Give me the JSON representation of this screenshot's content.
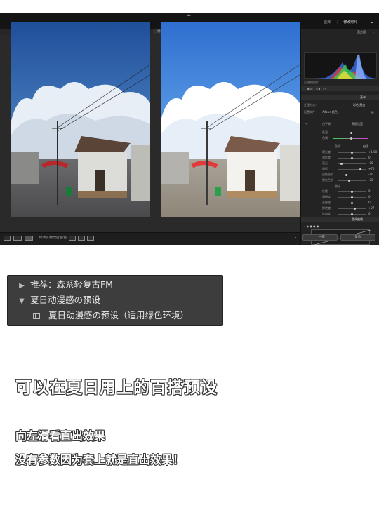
{
  "app": {
    "modules": [
      "图库",
      "修改照片"
    ],
    "active_module": "修改照片",
    "cloud_icon": "cloud-icon"
  },
  "view": {
    "before_label": "修改前",
    "after_label": "修改后",
    "toolbar_text": "修改前/修改后左/右"
  },
  "panel": {
    "histogram_label": "直方图",
    "basic_label": "基本",
    "profile_label": "配置文件",
    "profile_value": "Adobe 颜色",
    "wb_label": "白平衡",
    "wb_value": "原照设置",
    "tone_label": "色调",
    "auto_label": "自动",
    "presence_label": "偏好",
    "curve_label": "色调曲线",
    "sliders": [
      {
        "name": "色温",
        "value": ""
      },
      {
        "name": "色调",
        "value": ""
      },
      {
        "name": "曝光度",
        "value": "+1.00"
      },
      {
        "name": "对比度",
        "value": "0"
      },
      {
        "name": "高光",
        "value": "-80"
      },
      {
        "name": "阴影",
        "value": "+70"
      },
      {
        "name": "白色色阶",
        "value": "-40"
      },
      {
        "name": "黑色色阶",
        "value": "-20"
      },
      {
        "name": "纹理",
        "value": "0"
      },
      {
        "name": "清晰度",
        "value": "0"
      },
      {
        "name": "去朦胧",
        "value": "0"
      },
      {
        "name": "鲜艳度",
        "value": "+27"
      },
      {
        "name": "饱和度",
        "value": "0"
      }
    ],
    "prev_button": "上一张",
    "reset_button": "复位"
  },
  "presets": [
    {
      "arrow": "▶",
      "label": "推荐：森系轻复古FM"
    },
    {
      "arrow": "▼",
      "label": "夏日动漫感の预设"
    },
    {
      "arrow": "",
      "label": "夏日动漫感の预设（适用绿色环境）"
    }
  ],
  "text": {
    "heading": "可以在夏日用上的百搭预设",
    "line1": "向左滑看直出效果",
    "line2": "没有参数因为套上就是直出效果！"
  },
  "colors": {
    "sky_top": "#2b5da8",
    "sky_after": "#3b82d8",
    "accent_red": "#c0392b"
  }
}
